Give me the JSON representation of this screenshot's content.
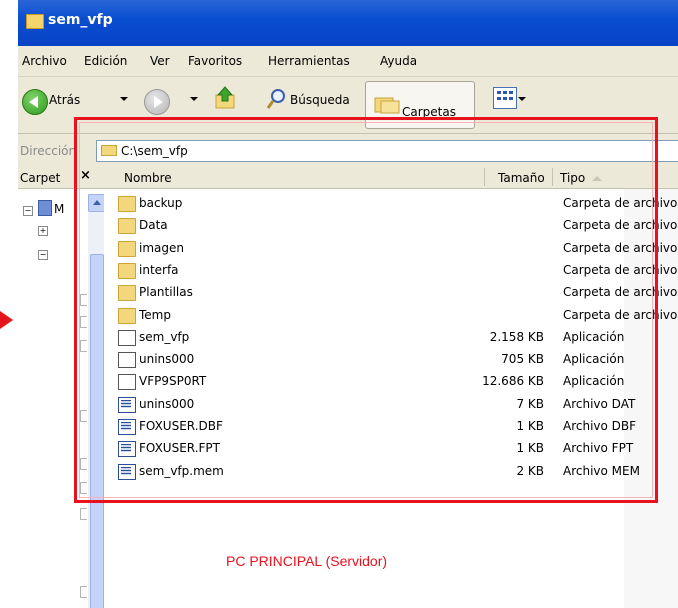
{
  "window": {
    "title": "sem_vfp"
  },
  "menu": [
    "Archivo",
    "Edición",
    "Ver",
    "Favoritos",
    "Herramientas",
    "Ayuda"
  ],
  "toolbar": {
    "back_label": "Atrás",
    "search_label": "Búsqueda",
    "folders_label": "Carpetas"
  },
  "address": {
    "label": "Dirección",
    "value": "C:\\sem_vfp"
  },
  "left_pane": {
    "title": "Carpet",
    "close": "×",
    "tree_label": "M"
  },
  "columns": {
    "name": "Nombre",
    "size": "Tamaño",
    "type": "Tipo"
  },
  "files": [
    {
      "name": "backup",
      "size": "",
      "type": "Carpeta de archivos",
      "icon": "folder-icon"
    },
    {
      "name": "Data",
      "size": "",
      "type": "Carpeta de archivos",
      "icon": "folder-icon"
    },
    {
      "name": "imagen",
      "size": "",
      "type": "Carpeta de archivos",
      "icon": "folder-icon"
    },
    {
      "name": "interfa",
      "size": "",
      "type": "Carpeta de archivos",
      "icon": "folder-icon"
    },
    {
      "name": "Plantillas",
      "size": "",
      "type": "Carpeta de archivos",
      "icon": "folder-icon"
    },
    {
      "name": "Temp",
      "size": "",
      "type": "Carpeta de archivos",
      "icon": "folder-icon"
    },
    {
      "name": "sem_vfp",
      "size": "2.158 KB",
      "type": "Aplicación",
      "icon": "application-icon"
    },
    {
      "name": "unins000",
      "size": "705 KB",
      "type": "Aplicación",
      "icon": "installer-icon"
    },
    {
      "name": "VFP9SP0RT",
      "size": "12.686 KB",
      "type": "Aplicación",
      "icon": "application-icon"
    },
    {
      "name": "unins000",
      "size": "7 KB",
      "type": "Archivo DAT",
      "icon": "data-file-icon"
    },
    {
      "name": "FOXUSER.DBF",
      "size": "1 KB",
      "type": "Archivo DBF",
      "icon": "data-file-icon"
    },
    {
      "name": "FOXUSER.FPT",
      "size": "1 KB",
      "type": "Archivo FPT",
      "icon": "data-file-icon"
    },
    {
      "name": "sem_vfp.mem",
      "size": "2 KB",
      "type": "Archivo MEM",
      "icon": "data-file-icon"
    }
  ],
  "annotation": {
    "caption": "PC PRINCIPAL (Servidor)",
    "color": "#e8121e"
  }
}
